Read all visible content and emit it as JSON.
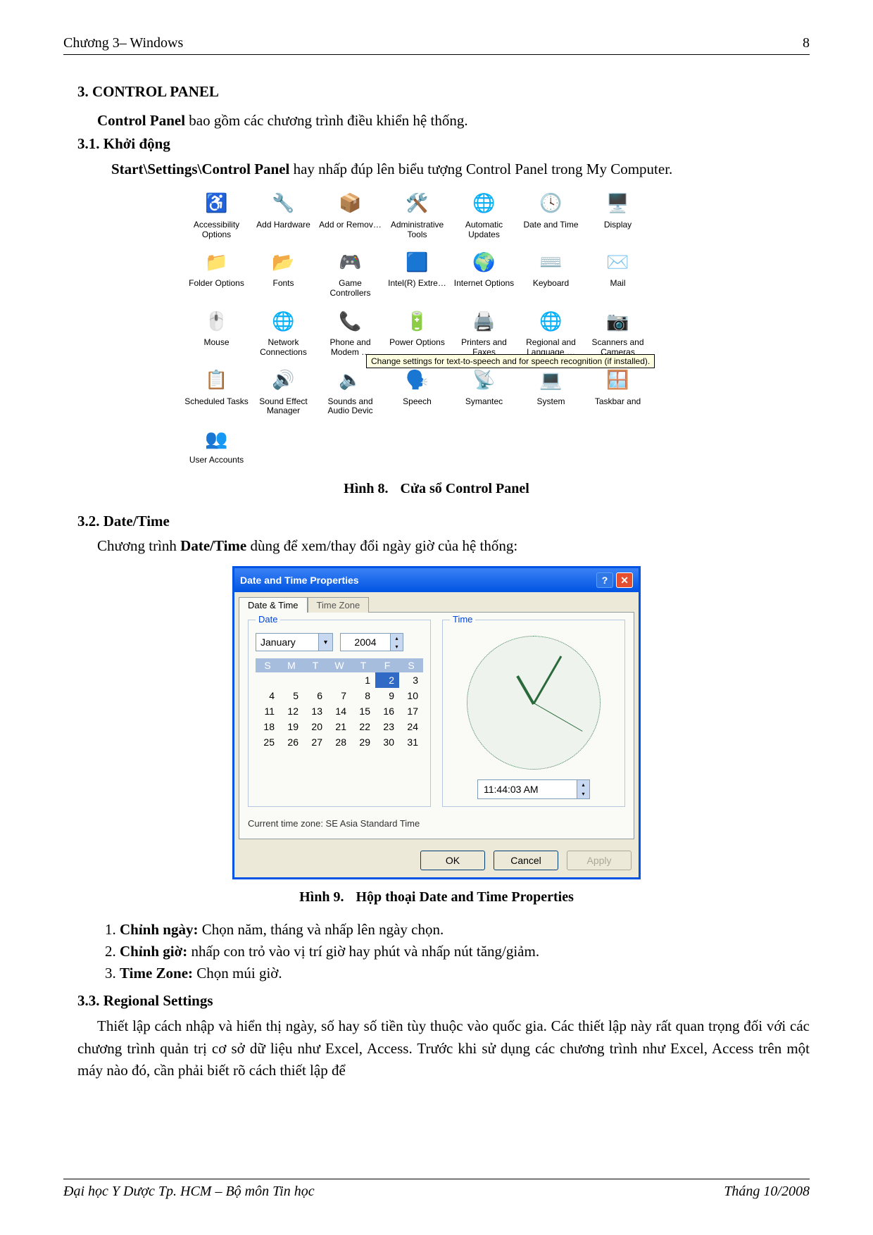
{
  "header": {
    "left": "Chương 3– Windows",
    "right": "8"
  },
  "footer": {
    "left": "Đại học Y Dược Tp. HCM – Bộ môn Tin học",
    "right": "Tháng 10/2008"
  },
  "s3": {
    "title": "3. CONTROL PANEL",
    "intro_bold": "Control Panel",
    "intro_rest": " bao gồm các chương trình điều khiển hệ thống."
  },
  "s31": {
    "title": "3.1. Khởi động",
    "line_bold": "Start\\Settings\\Control Panel",
    "line_rest": " hay nhấp đúp lên biểu tượng Control Panel trong My Computer."
  },
  "cp_icons": [
    [
      {
        "label": "Accessibility Options",
        "glyph": "♿"
      },
      {
        "label": "Add Hardware",
        "glyph": "🔧"
      },
      {
        "label": "Add or Remov…",
        "glyph": "📦"
      },
      {
        "label": "Administrative Tools",
        "glyph": "🛠️"
      },
      {
        "label": "Automatic Updates",
        "glyph": "🌐"
      },
      {
        "label": "Date and Time",
        "glyph": "🕓"
      },
      {
        "label": "Display",
        "glyph": "🖥️"
      }
    ],
    [
      {
        "label": "Folder Options",
        "glyph": "📁"
      },
      {
        "label": "Fonts",
        "glyph": "📂"
      },
      {
        "label": "Game Controllers",
        "glyph": "🎮"
      },
      {
        "label": "Intel(R) Extre…",
        "glyph": "🟦"
      },
      {
        "label": "Internet Options",
        "glyph": "🌍"
      },
      {
        "label": "Keyboard",
        "glyph": "⌨️"
      },
      {
        "label": "Mail",
        "glyph": "✉️"
      }
    ],
    [
      {
        "label": "Mouse",
        "glyph": "🖱️"
      },
      {
        "label": "Network Connections",
        "glyph": "🌐"
      },
      {
        "label": "Phone and Modem …",
        "glyph": "📞"
      },
      {
        "label": "Power Options",
        "glyph": "🔋"
      },
      {
        "label": "Printers and Faxes",
        "glyph": "🖨️"
      },
      {
        "label": "Regional and Language …",
        "glyph": "🌐"
      },
      {
        "label": "Scanners and Cameras",
        "glyph": "📷"
      }
    ],
    [
      {
        "label": "Scheduled Tasks",
        "glyph": "📋"
      },
      {
        "label": "Sound Effect Manager",
        "glyph": "🔊"
      },
      {
        "label": "Sounds and Audio Devic",
        "glyph": "🔈"
      },
      {
        "label": "Speech",
        "glyph": "🗣️"
      },
      {
        "label": "Symantec",
        "glyph": "📡"
      },
      {
        "label": "System",
        "glyph": "💻"
      },
      {
        "label": "Taskbar and",
        "glyph": "🪟"
      }
    ],
    [
      {
        "label": "User Accounts",
        "glyph": "👥"
      }
    ]
  ],
  "cp_tooltip": "Change settings for text-to-speech and for speech recognition (if installed).",
  "fig8": {
    "num": "Hình 8.",
    "text": "Cửa sổ Control Panel"
  },
  "s32": {
    "title": "3.2. Date/Time",
    "intro_pre": "Chương trình ",
    "intro_bold": "Date/Time",
    "intro_post": " dùng để xem/thay đổi ngày giờ của hệ thống:"
  },
  "dt": {
    "title": "Date and Time Properties",
    "tabs": [
      "Date & Time",
      "Time Zone"
    ],
    "date_legend": "Date",
    "time_legend": "Time",
    "month": "January",
    "year": "2004",
    "dow": [
      "S",
      "M",
      "T",
      "W",
      "T",
      "F",
      "S"
    ],
    "weeks": [
      [
        "",
        "",
        "",
        "",
        "1",
        "2",
        "3"
      ],
      [
        "4",
        "5",
        "6",
        "7",
        "8",
        "9",
        "10"
      ],
      [
        "11",
        "12",
        "13",
        "14",
        "15",
        "16",
        "17"
      ],
      [
        "18",
        "19",
        "20",
        "21",
        "22",
        "23",
        "24"
      ],
      [
        "25",
        "26",
        "27",
        "28",
        "29",
        "30",
        "31"
      ]
    ],
    "selected_day": "2",
    "time_value": "11:44:03 AM",
    "tz_text": "Current time zone: SE Asia Standard Time",
    "buttons": {
      "ok": "OK",
      "cancel": "Cancel",
      "apply": "Apply"
    }
  },
  "fig9": {
    "num": "Hình 9.",
    "text": "Hộp thoại Date and Time Properties"
  },
  "list32": [
    {
      "bold": "Chỉnh ngày:",
      "rest": " Chọn năm, tháng và nhấp lên ngày chọn."
    },
    {
      "bold": "Chỉnh giờ:",
      "rest": " nhấp con trỏ vào vị trí giờ hay phút và nhấp nút tăng/giảm."
    },
    {
      "bold": "Time Zone:",
      "rest": " Chọn múi giờ."
    }
  ],
  "s33": {
    "title": "3.3. Regional Settings",
    "body": "Thiết lập cách nhập và hiển thị ngày, số hay số tiền tùy thuộc vào quốc gia. Các thiết lập này rất quan trọng đối với các chương trình quản trị cơ sở dữ liệu như Excel, Access. Trước khi sử dụng các chương trình như Excel, Access trên một máy nào đó, cần phải biết rõ cách thiết lập để"
  }
}
